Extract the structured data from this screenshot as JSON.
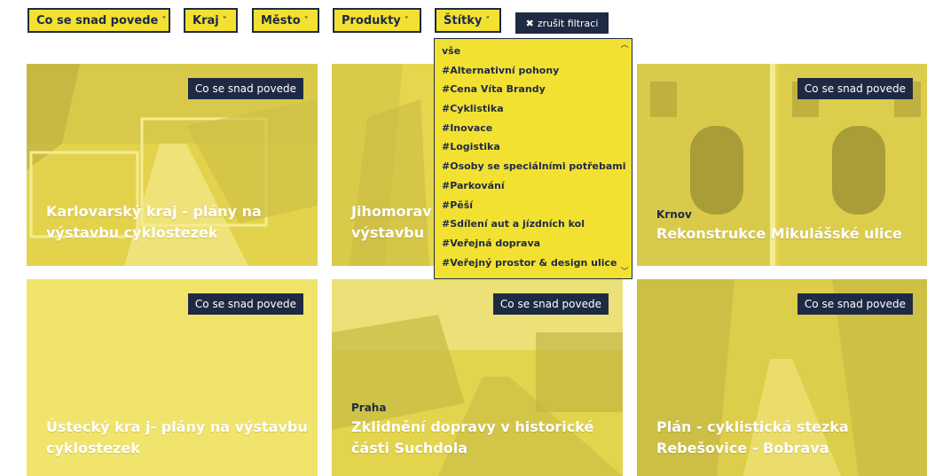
{
  "filters": {
    "success": "Co se snad povede",
    "region": "Kraj",
    "city": "Město",
    "products": "Produkty",
    "tags": "Štítky",
    "caret": "˅",
    "clear": "zrušit filtraci",
    "clear_icon": "✖"
  },
  "tags_dropdown": {
    "items": [
      "vše",
      "#Alternativní pohony",
      "#Cena Víta Brandy",
      "#Cyklistika",
      "#Inovace",
      "#Logistika",
      "#Osoby se speciálními potřebami",
      "#Parkování",
      "#Pěší",
      "#Sdílení aut a jízdních kol",
      "#Veřejná doprava",
      "#Veřejný prostor & design ulice"
    ]
  },
  "cards": [
    {
      "badge": "Co se snad povede",
      "city": "",
      "title": "Karlovarský kraj - plány na výstavbu cyklostezek"
    },
    {
      "badge": "",
      "city": "",
      "title": "Jihomorav výstavbu"
    },
    {
      "badge": "Co se snad povede",
      "city": "Krnov",
      "title": "Rekonstrukce Mikulášské ulice"
    },
    {
      "badge": "Co se snad povede",
      "city": "",
      "title": "Ústecký kra j- plány na výstavbu cyklostezek"
    },
    {
      "badge": "Co se snad povede",
      "city": "Praha",
      "title": "Zklidnění dopravy v historické části Suchdola"
    },
    {
      "badge": "Co se snad povede",
      "city": "",
      "title": "Plán - cyklistická stezka Rebešovice - Bobrava"
    }
  ],
  "colors": {
    "accent_yellow": "#f3e132",
    "navy": "#1e2a44",
    "card_yellow": "#ecdd52"
  }
}
